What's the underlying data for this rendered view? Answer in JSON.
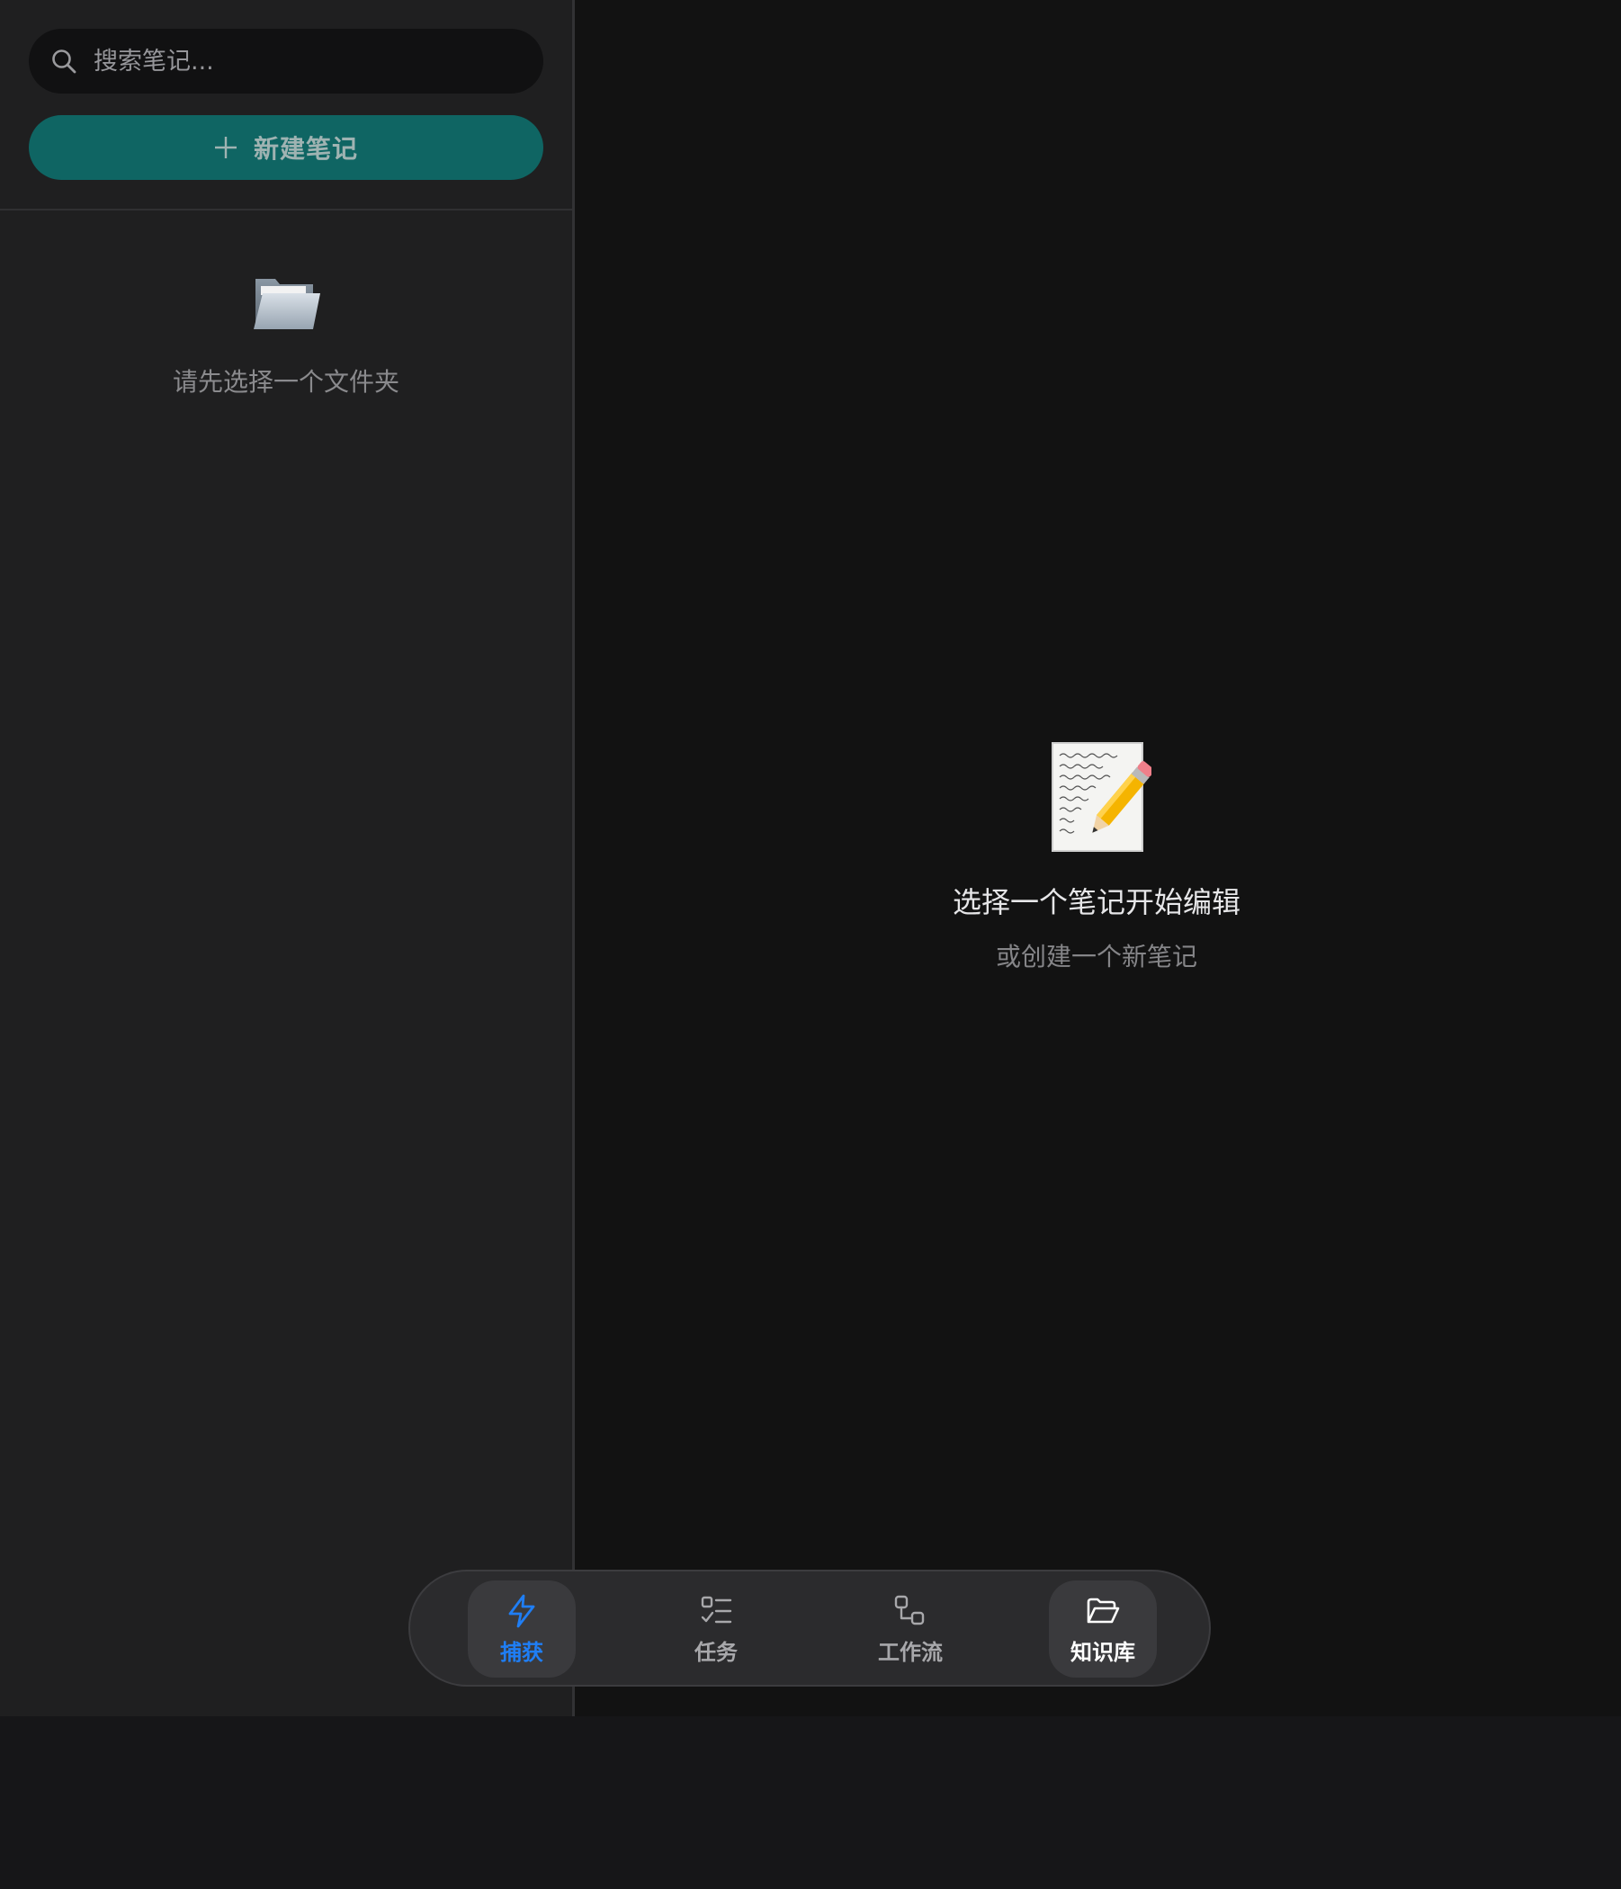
{
  "sidebar": {
    "search": {
      "placeholder": "搜索笔记...",
      "icon": "search-icon"
    },
    "new_note_button": {
      "label": "新建笔记",
      "icon": "plus-icon"
    },
    "empty_state": {
      "icon": "open-folder-icon",
      "text": "请先选择一个文件夹"
    }
  },
  "main": {
    "empty_state": {
      "icon": "memo-pencil-icon",
      "title": "选择一个笔记开始编辑",
      "subtitle": "或创建一个新笔记"
    }
  },
  "tabbar": {
    "tabs": [
      {
        "label": "捕获",
        "icon": "lightning-icon",
        "active": true,
        "color": "#1f7ef5"
      },
      {
        "label": "任务",
        "icon": "checklist-icon",
        "active": false
      },
      {
        "label": "工作流",
        "icon": "workflow-icon",
        "active": false
      },
      {
        "label": "知识库",
        "icon": "folder-icon",
        "active": true,
        "color": "#ffffff"
      }
    ]
  },
  "colors": {
    "accent": "#0f6563",
    "active_tab": "#1f7ef5",
    "sidebar_bg": "#1f1f20",
    "main_bg": "#121212"
  }
}
